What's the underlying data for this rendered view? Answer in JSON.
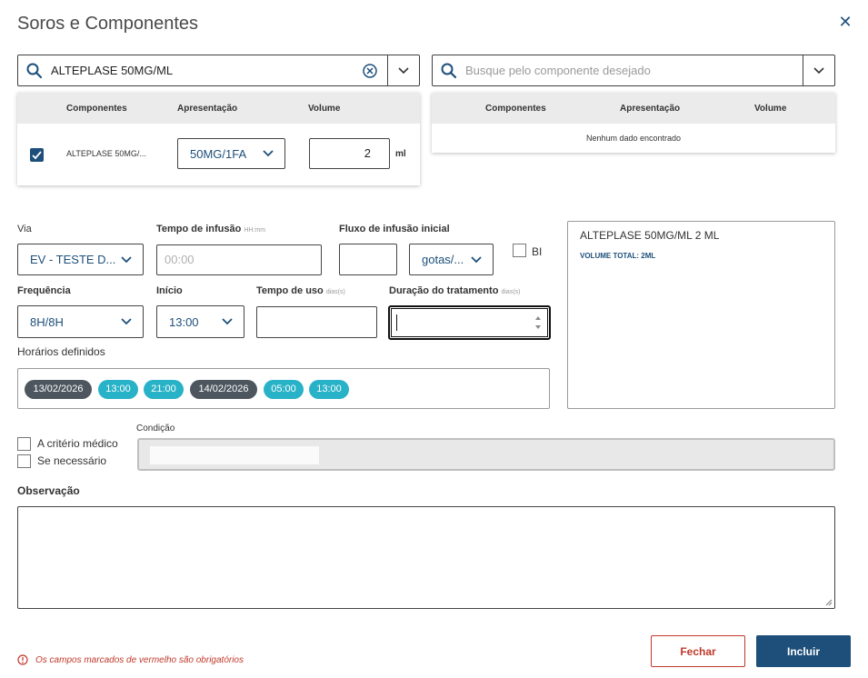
{
  "dialog": {
    "title": "Soros e Componentes",
    "close_glyph": "✕"
  },
  "left_search": {
    "value": "ALTEPLASE 50MG/ML",
    "clear_icon": "circle-x-icon"
  },
  "right_search": {
    "placeholder": "Busque pelo componente desejado"
  },
  "left_table": {
    "headers": [
      "Componentes",
      "Apresentação",
      "Volume"
    ],
    "row": {
      "checked": true,
      "component": "ALTEPLASE 50MG/...",
      "presentation": "50MG/1FA",
      "volume": "2",
      "unit": "ml"
    }
  },
  "right_table": {
    "headers": [
      "Componentes",
      "Apresentação",
      "Volume"
    ],
    "empty": "Nenhum dado encontrado"
  },
  "form": {
    "via_label": "Via",
    "via_value": "EV - TESTE D...",
    "tempo_infusao_label": "Tempo de infusão",
    "tempo_infusao_hint": "HH:mm",
    "tempo_infusao_placeholder": "00:00",
    "fluxo_label": "Fluxo de infusão inicial",
    "fluxo_unit": "gotas/...",
    "bi_label": "BI",
    "frequencia_label": "Frequência",
    "frequencia_value": "8H/8H",
    "inicio_label": "Início",
    "inicio_value": "13:00",
    "tempo_uso_label": "Tempo de uso",
    "tempo_uso_hint": "dias(s)",
    "duracao_label": "Duração do tratamento",
    "duracao_hint": "dias(s)",
    "horarios_label": "Horários definidos",
    "horarios": [
      "13/02/2026",
      "13:00",
      "21:00",
      "14/02/2026",
      "05:00",
      "13:00"
    ],
    "criterio_label": "A critério médico",
    "necessario_label": "Se necessário",
    "condicao_label": "Condição",
    "observacao_label": "Observação"
  },
  "summary": {
    "line": "ALTEPLASE 50MG/ML 2 ML",
    "total": "VOLUME TOTAL: 2ML"
  },
  "footer": {
    "required_note": "Os campos marcados de vermelho são obrigatórios",
    "close_label": "Fechar",
    "include_label": "Incluir"
  },
  "colors": {
    "accent": "#1d4f7a",
    "date_chip": "#4d565e",
    "time_chip": "#28b2c7",
    "danger": "#c0392b"
  }
}
